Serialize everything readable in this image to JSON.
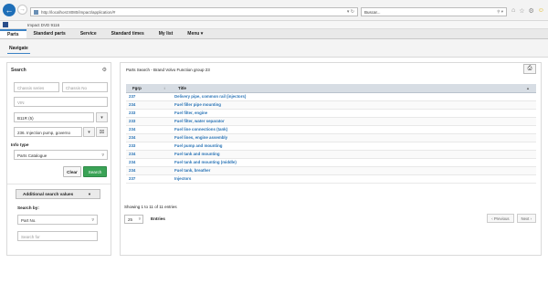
{
  "browser": {
    "address": "http://localhost:8080/impact/application/#",
    "search_placeholder": "Buscar..."
  },
  "app_title": "Impact DVD 9116",
  "menu": {
    "items": [
      "Parts",
      "Standard parts",
      "Service",
      "Standard times",
      "My list",
      "Menu ▾"
    ]
  },
  "subnav": {
    "tab": "Navigate"
  },
  "search_panel": {
    "title": "Search",
    "chassis_series_placeholder": "Chassis series",
    "chassis_no_placeholder": "Chassis No",
    "vin_placeholder": "VIN",
    "model_value": "B11R (5)",
    "function_group_value": "236. Injection pump, governo",
    "info_type_label": "Info type",
    "info_type_value": "Parts Catalogue",
    "clear_label": "Clear",
    "search_label": "Search",
    "additional_label": "Additional search values",
    "search_by_label": "Search by:",
    "search_by_value": "Part No.",
    "search_for_placeholder": "Search for"
  },
  "results": {
    "title": "Parts Search - Brand Volvo Function group 23",
    "columns": [
      "Fgrp",
      "Title"
    ],
    "rows": [
      {
        "fgrp": "237",
        "title": "Delivery pipe, common rail (injectors)"
      },
      {
        "fgrp": "234",
        "title": "Fuel filler pipe mounting"
      },
      {
        "fgrp": "233",
        "title": "Fuel filter, engine"
      },
      {
        "fgrp": "233",
        "title": "Fuel filter, water separator"
      },
      {
        "fgrp": "234",
        "title": "Fuel line connections (tank)"
      },
      {
        "fgrp": "234",
        "title": "Fuel lines, engine assembly"
      },
      {
        "fgrp": "233",
        "title": "Fuel pump and mounting"
      },
      {
        "fgrp": "234",
        "title": "Fuel tank and mounting"
      },
      {
        "fgrp": "234",
        "title": "Fuel tank and mounting (middle)"
      },
      {
        "fgrp": "234",
        "title": "Fuel tank, breather"
      },
      {
        "fgrp": "237",
        "title": "Injectors"
      }
    ],
    "showing": "Showing 1 to 11 of 11 entries",
    "page_size": "25",
    "entries_label": "Entries",
    "prev_label": "Previous",
    "next_label": "Next"
  },
  "colors": {
    "accent": "#3b82c4",
    "link": "#2a74b6",
    "search_button": "#3aa356",
    "table_header": "#d7dde4"
  }
}
